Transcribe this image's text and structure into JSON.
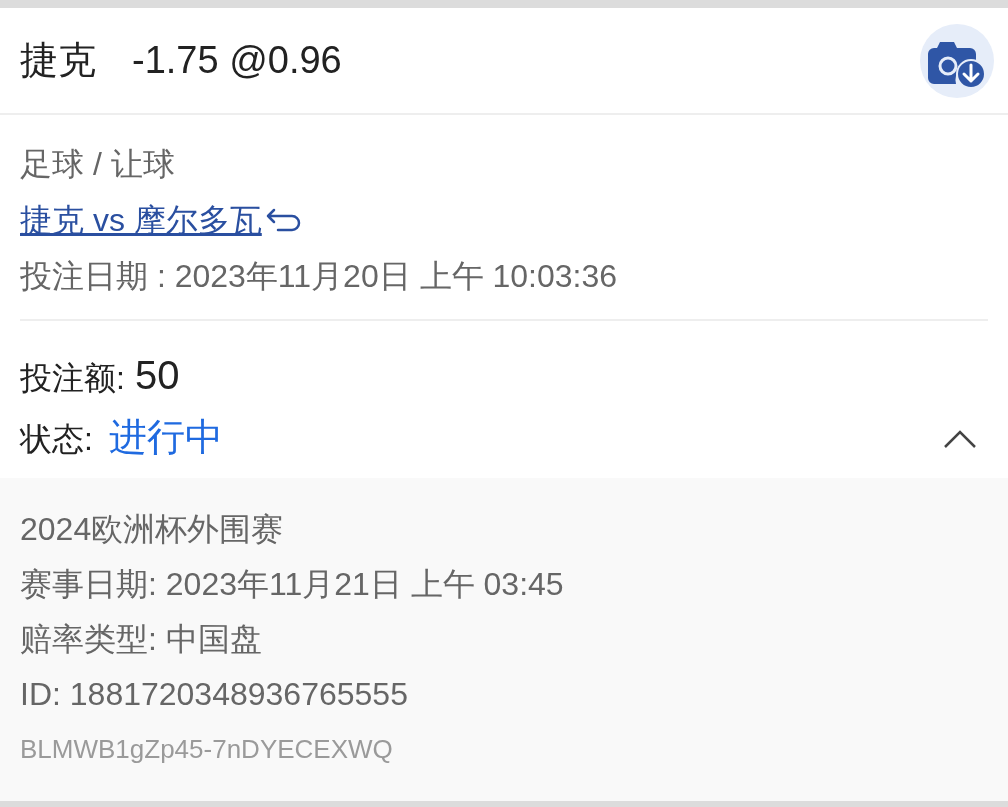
{
  "header": {
    "team": "捷克",
    "odds": "-1.75 @0.96"
  },
  "bet": {
    "sport": "足球 / 让球",
    "match_link": "捷克 vs 摩尔多瓦",
    "bet_date": "投注日期 : 2023年11月20日 上午 10:03:36"
  },
  "summary": {
    "stake_label": "投注额:",
    "stake": "50",
    "status_label": "状态:",
    "status": "进行中",
    "expanded": true
  },
  "details": [
    {
      "kind": "text",
      "text": "2024欧洲杯外围赛"
    },
    {
      "kind": "text",
      "text": "赛事日期: 2023年11月21日 上午 03:45"
    },
    {
      "kind": "text",
      "text": "赔率类型: 中国盘"
    },
    {
      "kind": "text",
      "text": "ID: 1881720348936765555"
    },
    {
      "kind": "code",
      "text": "BLMWB1gZp45-7nDYECEXWQ"
    }
  ]
}
